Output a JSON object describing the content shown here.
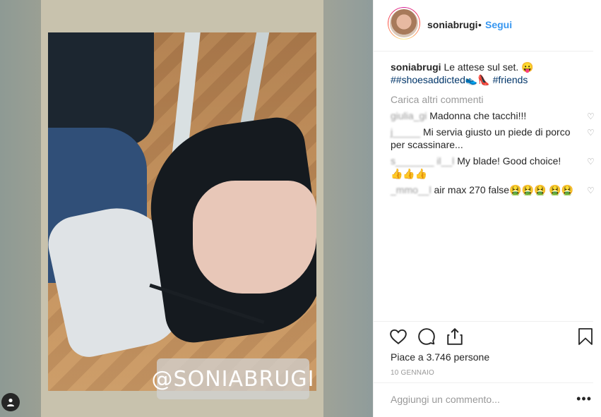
{
  "post": {
    "watermark": "@SONIABRUGI",
    "username": "soniabrugi",
    "separator": "•",
    "follow_label": "Segui"
  },
  "caption": {
    "user": "soniabrugi",
    "text": "Le attese sul set. 😛",
    "tags": "##shoesaddicted👟👠 #friends"
  },
  "load_more": "Carica altri commenti",
  "comments": [
    {
      "user": "giulia_gi",
      "text": "Madonna che tacchi!!!"
    },
    {
      "user": "j_____",
      "text": "Mi servia giusto un piede di porco per scassinare..."
    },
    {
      "user": "s_______ il__l",
      "text": "My blade! Good choice! 👍👍👍"
    },
    {
      "user": "_mmo__l",
      "text": "air max 270 false🤮🤮🤮 🤮🤮"
    }
  ],
  "likes_text": "Piace a 3.746 persone",
  "date": "10 GENNAIO",
  "add_comment_placeholder": "Aggiungi un commento...",
  "more_label": "•••",
  "icons": {
    "like": "heart-icon",
    "comment": "comment-icon",
    "share": "share-icon",
    "save": "bookmark-icon",
    "tag": "user-tag-icon"
  },
  "colors": {
    "link": "#3897f0",
    "hashtag": "#003569",
    "muted": "#999999"
  }
}
